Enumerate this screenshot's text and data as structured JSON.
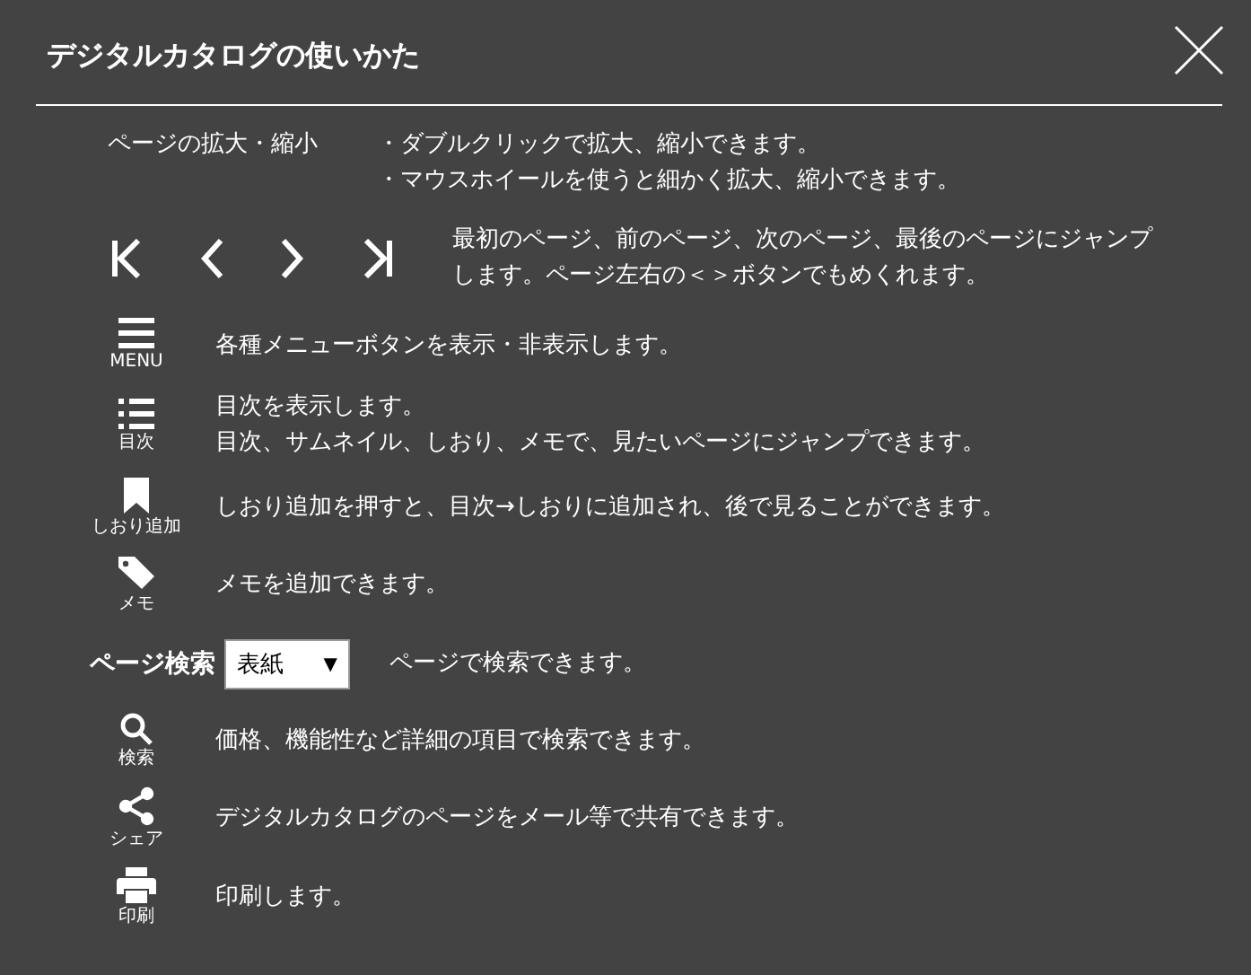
{
  "window": {
    "title": "デジタルカタログの使いかた"
  },
  "rows": [
    {
      "kind": "zoom",
      "label": "ページの拡大・縮小",
      "lines": [
        "・ダブルクリックで拡大、縮小できます。",
        "・マウスホイールを使うと細かく拡大、縮小できます。"
      ]
    },
    {
      "kind": "nav",
      "lines": [
        "最初のページ、前のページ、次のページ、最後のページにジャンプします。ページ左右の＜＞ボタンでもめくれます。"
      ]
    },
    {
      "kind": "menu",
      "caption": "MENU",
      "lines": [
        "各種メニューボタンを表示・非表示します。"
      ]
    },
    {
      "kind": "toc",
      "caption": "目次",
      "lines": [
        "目次を表示します。",
        "目次、サムネイル、しおり、メモで、見たいページにジャンプできます。"
      ]
    },
    {
      "kind": "bookmark",
      "caption": "しおり追加",
      "lines": [
        "しおり追加を押すと、目次→しおりに追加され、後で見ることができます。"
      ]
    },
    {
      "kind": "memo",
      "caption": "メモ",
      "lines": [
        "メモを追加できます。"
      ]
    },
    {
      "kind": "page-search",
      "label": "ページ検索",
      "select": {
        "value": "表紙",
        "arrow": "▼"
      },
      "lines": [
        "ページで検索できます。"
      ]
    },
    {
      "kind": "search",
      "caption": "検索",
      "lines": [
        "価格、機能性など詳細の項目で検索できます。"
      ]
    },
    {
      "kind": "share",
      "caption": "シェア",
      "lines": [
        "デジタルカタログのページをメール等で共有できます。"
      ]
    },
    {
      "kind": "print",
      "caption": "印刷",
      "lines": [
        "印刷します。"
      ]
    }
  ]
}
